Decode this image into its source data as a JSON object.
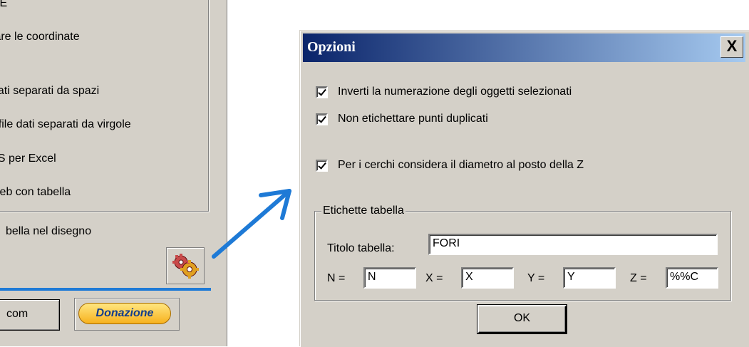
{
  "background_window": {
    "group_top_text": "NE",
    "items": [
      "tare le coordinate",
      "dati separati da spazi",
      "- file dati separati da virgole",
      "LS per Excel",
      "web con tabella"
    ],
    "table_label": "bella nel disegno",
    "com_button": "com",
    "donate_button": "Donazione",
    "gear_icon": "gears-icon"
  },
  "dialog": {
    "title": "Opzioni",
    "close_label": "X",
    "checkboxes": [
      {
        "label": "Inverti la numerazione degli oggetti selezionati",
        "checked": true
      },
      {
        "label": "Non etichettare punti duplicati",
        "checked": true
      },
      {
        "label": "Per i cerchi considera il diametro al posto della Z",
        "checked": true
      }
    ],
    "group": {
      "legend": "Etichette tabella",
      "title_label": "Titolo tabella:",
      "title_value": "FORI",
      "n_label": "N =",
      "n_value": "N",
      "x_label": "X =",
      "x_value": "X",
      "y_label": "Y =",
      "y_value": "Y",
      "z_label": "Z =",
      "z_value": "%%C"
    },
    "ok_label": "OK"
  },
  "colors": {
    "title_gradient_start": "#0a246a",
    "title_gradient_end": "#a6caf0",
    "arrow": "#1e7ad6",
    "face": "#d4d0c8"
  }
}
